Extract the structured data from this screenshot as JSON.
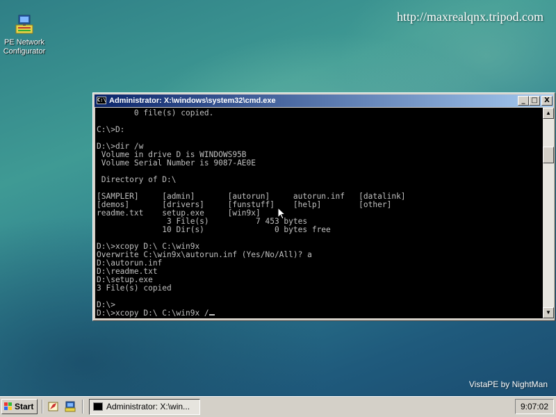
{
  "desktop": {
    "icon_label": "PE Network Configurator",
    "url": "http://maxrealqnx.tripod.com",
    "branding": "VistaPE by NightMan"
  },
  "window": {
    "title": "Administrator: X:\\windows\\system32\\cmd.exe",
    "minimize": "_",
    "maximize": "□",
    "close": "X",
    "icon_text": "C:\\"
  },
  "console": {
    "lines": [
      "        0 file(s) copied.",
      "",
      "C:\\>D:",
      "",
      "D:\\>dir /w",
      " Volume in drive D is WINDOWS95B",
      " Volume Serial Number is 9087-AE0E",
      "",
      " Directory of D:\\",
      "",
      "[SAMPLER]     [admin]       [autorun]     autorun.inf   [datalink]",
      "[demos]       [drivers]     [funstuff]    [help]        [other]",
      "readme.txt    setup.exe     [win9x]",
      "               3 File(s)          7 453 bytes",
      "              10 Dir(s)               0 bytes free",
      "",
      "D:\\>xcopy D:\\ C:\\win9x",
      "Overwrite C:\\win9x\\autorun.inf (Yes/No/All)? a",
      "D:\\autorun.inf",
      "D:\\readme.txt",
      "D:\\setup.exe",
      "3 File(s) copied",
      "",
      "D:\\>",
      "D:\\>xcopy D:\\ C:\\win9x /"
    ]
  },
  "taskbar": {
    "start_label": "Start",
    "task_label": "Administrator: X:\\win...",
    "clock": "9:07:02"
  },
  "icons": [
    "network-config-icon",
    "cmd-icon",
    "start-flag-icon",
    "quick-launch-icon",
    "mouse-pointer-icon"
  ]
}
